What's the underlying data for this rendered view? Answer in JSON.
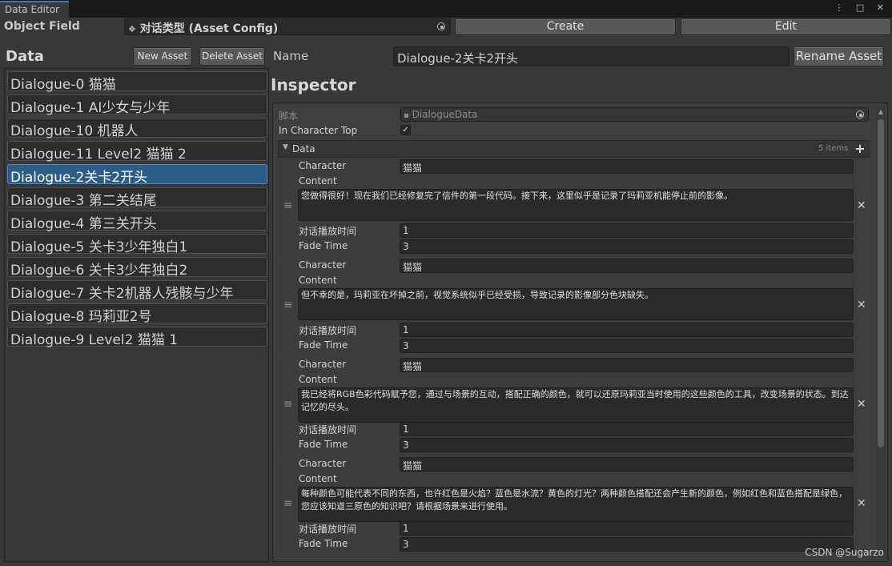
{
  "window": {
    "tab_title": "Data Editor",
    "controls": "⋮ □ ✕"
  },
  "toolbar": {
    "object_field_label": "Object Field",
    "object_field_value": "对话类型 (Asset Config)",
    "create_label": "Create",
    "edit_label": "Edit"
  },
  "data_panel": {
    "title": "Data",
    "new_asset_label": "New Asset",
    "delete_asset_label": "Delete Asset",
    "items": [
      "Dialogue-0 猫猫",
      "Dialogue-1 AI少女与少年",
      "Dialogue-10 机器人",
      "Dialogue-11 Level2 猫猫 2",
      "Dialogue-2关卡2开头",
      "Dialogue-3 第二关结尾",
      "Dialogue-4 第三关开头",
      "Dialogue-5 关卡3少年独白1",
      "Dialogue-6 关卡3少年独白2",
      "Dialogue-7 关卡2机器人残骸与少年",
      "Dialogue-8 玛莉亚2号",
      "Dialogue-9 Level2 猫猫 1"
    ],
    "selected_index": 4
  },
  "name_row": {
    "label": "Name",
    "value": "Dialogue-2关卡2开头",
    "rename_label": "Rename Asset"
  },
  "inspector": {
    "title": "Inspector",
    "script_label": "脚本",
    "script_value": "DialogueData",
    "in_character_top_label": "In Character Top",
    "in_character_top_checked": true,
    "check_mark": "✓",
    "data_label": "Data",
    "data_count": "5 items",
    "add_button": "+",
    "remove_button": "✕",
    "handle": "≡",
    "field_labels": {
      "character": "Character",
      "content": "Content",
      "play_time": "对话播放时间",
      "fade_time": "Fade Time"
    },
    "elements": [
      {
        "character": "猫猫",
        "content": "您做得很好！现在我们已经修复完了信件的第一段代码。接下来，这里似乎是记录了玛莉亚机能停止前的影像。",
        "play_time": "1",
        "fade_time": "3"
      },
      {
        "character": "猫猫",
        "content": "但不幸的是，玛莉亚在坏掉之前，视觉系统似乎已经受损，导致记录的影像部分色块缺失。",
        "play_time": "1",
        "fade_time": "3"
      },
      {
        "character": "猫猫",
        "content": "我已经将RGB色彩代码赋予您，通过与场景的互动，搭配正确的颜色，就可以还原玛莉亚当时使用的这些颜色的工具，改变场景的状态。到达记忆的尽头。",
        "play_time": "1",
        "fade_time": "3"
      },
      {
        "character": "猫猫",
        "content": "每种颜色可能代表不同的东西，也许红色是火焰？蓝色是水流？黄色的灯光？两种颜色搭配还会产生新的颜色，例如红色和蓝色搭配是绿色，您应该知道三原色的知识吧？请根据场景来进行使用。",
        "play_time": "1",
        "fade_time": "3"
      }
    ]
  },
  "watermark": "CSDN @Sugarzo"
}
